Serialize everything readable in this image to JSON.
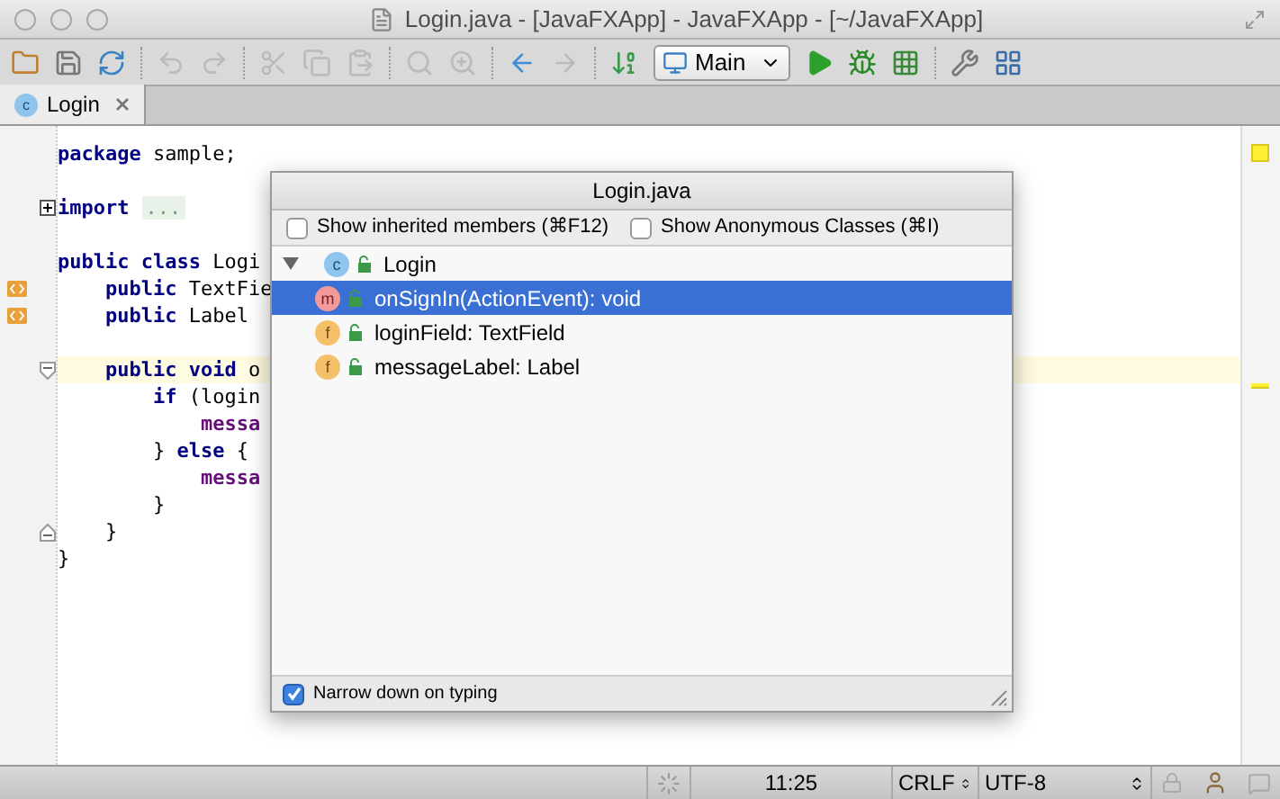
{
  "window": {
    "title": "Login.java - [JavaFXApp] - JavaFXApp - [~/JavaFXApp]"
  },
  "toolbar": {
    "run_config": "Main"
  },
  "tabs": [
    {
      "label": "Login",
      "icon_letter": "c",
      "selected": true
    }
  ],
  "editor": {
    "lines": [
      {
        "kind": "code",
        "tokens": [
          {
            "kind": "keyword",
            "text": "package"
          },
          {
            "kind": "plain",
            "text": " sample;"
          }
        ]
      },
      {
        "kind": "blank"
      },
      {
        "kind": "code",
        "gutter_marker": {
          "kind": "fold_collapsed"
        },
        "tokens": [
          {
            "kind": "keyword",
            "text": "import"
          },
          {
            "kind": "fold",
            "text": "..."
          }
        ]
      },
      {
        "kind": "blank"
      },
      {
        "kind": "code",
        "tokens": [
          {
            "kind": "keyword",
            "text": "public class"
          },
          {
            "kind": "plain",
            "text": " Logi"
          }
        ]
      },
      {
        "kind": "code",
        "gutter_marker": {
          "kind": "override"
        },
        "tokens": [
          {
            "kind": "keyword",
            "text": "    public"
          },
          {
            "kind": "plain",
            "text": " TextFie"
          }
        ]
      },
      {
        "kind": "code",
        "gutter_marker": {
          "kind": "override"
        },
        "tokens": [
          {
            "kind": "keyword",
            "text": "    public"
          },
          {
            "kind": "plain",
            "text": " Label"
          }
        ]
      },
      {
        "kind": "blank"
      },
      {
        "kind": "code",
        "gutter_marker": {
          "kind": "fold_open"
        },
        "highlighted": true,
        "tokens": [
          {
            "kind": "keyword",
            "text": "    public void"
          },
          {
            "kind": "plain",
            "text": " o"
          }
        ]
      },
      {
        "kind": "code",
        "tokens": [
          {
            "kind": "keyword",
            "text": "        if"
          },
          {
            "kind": "plain",
            "text": " (login"
          }
        ]
      },
      {
        "kind": "code",
        "tokens": [
          {
            "kind": "field",
            "text": "            messa"
          }
        ]
      },
      {
        "kind": "code",
        "tokens": [
          {
            "kind": "plain",
            "text": "        } "
          },
          {
            "kind": "keyword",
            "text": "else"
          },
          {
            "kind": "plain",
            "text": " {"
          }
        ]
      },
      {
        "kind": "code",
        "tokens": [
          {
            "kind": "field",
            "text": "            messa"
          }
        ]
      },
      {
        "kind": "code",
        "tokens": [
          {
            "kind": "plain",
            "text": "        }"
          }
        ]
      },
      {
        "kind": "code",
        "gutter_marker": {
          "kind": "fold_end"
        },
        "tokens": [
          {
            "kind": "plain",
            "text": "    }"
          }
        ]
      },
      {
        "kind": "code",
        "tokens": [
          {
            "kind": "plain",
            "text": "}"
          }
        ]
      }
    ]
  },
  "structure_popup": {
    "title": "Login.java",
    "options": [
      {
        "label": "Show inherited members (⌘F12)",
        "checked": false
      },
      {
        "label": "Show Anonymous Classes (⌘I)",
        "checked": false
      }
    ],
    "tree": [
      {
        "label": "Login",
        "kind": "class",
        "letter": "c",
        "expanded": true,
        "selected": false,
        "children": [
          {
            "label": "onSignIn(ActionEvent): void",
            "kind": "method",
            "letter": "m",
            "selected": true
          },
          {
            "label": "loginField: TextField",
            "kind": "field",
            "letter": "f",
            "selected": false
          },
          {
            "label": "messageLabel: Label",
            "kind": "field",
            "letter": "f",
            "selected": false
          }
        ]
      }
    ],
    "footer_option": {
      "label": "Narrow down on typing",
      "checked": true
    }
  },
  "status_bar": {
    "position": "11:25",
    "line_separator": "CRLF",
    "encoding": "UTF-8"
  }
}
